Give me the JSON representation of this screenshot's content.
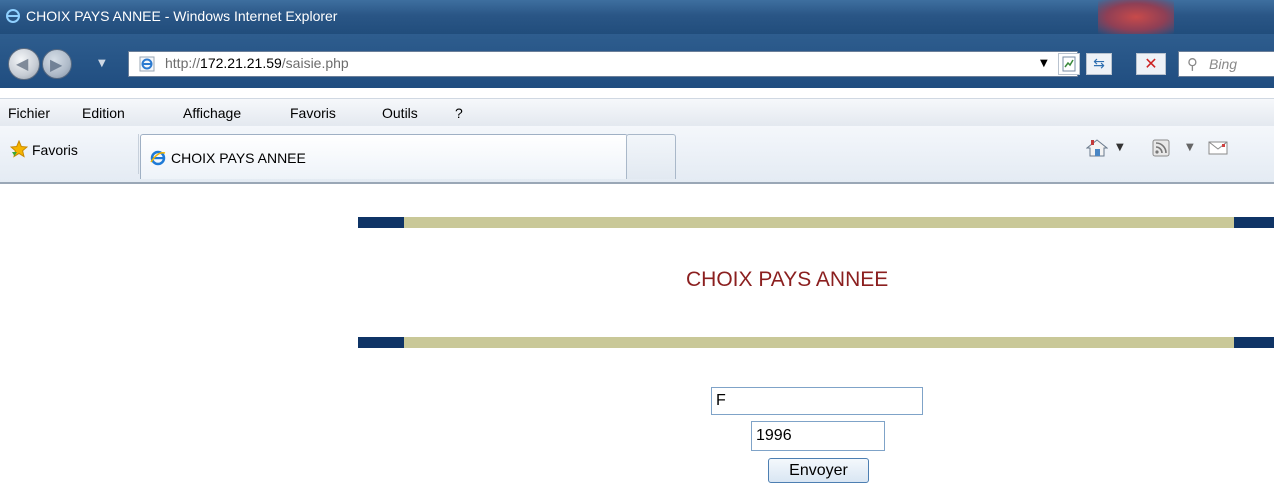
{
  "window": {
    "title": "CHOIX PAYS ANNEE - Windows Internet Explorer"
  },
  "addressbar": {
    "url_prefix": "http://",
    "url_host": "172.21.21.59",
    "url_path": "/saisie.php",
    "search_placeholder": "Bing"
  },
  "menu": {
    "items": [
      "Fichier",
      "Edition",
      "Affichage",
      "Favoris",
      "Outils",
      "?"
    ]
  },
  "favorites": {
    "label": "Favoris"
  },
  "tabs": {
    "active_label": "CHOIX PAYS ANNEE"
  },
  "page": {
    "heading": "CHOIX PAYS ANNEE",
    "pays_value": "F",
    "annee_value": "1996",
    "submit_label": "Envoyer"
  },
  "colors": {
    "band": "#c9c898",
    "band_cap": "#0f3466",
    "heading": "#8b1f1f",
    "titlebar": "#2a5686"
  },
  "icons": [
    "ie-logo-icon",
    "back-arrow-icon",
    "forward-arrow-icon",
    "page-ie-icon",
    "compat-view-icon",
    "refresh-icon",
    "stop-icon",
    "search-magnifier-icon",
    "favorites-star-icon",
    "home-icon",
    "feeds-icon",
    "mail-icon"
  ]
}
